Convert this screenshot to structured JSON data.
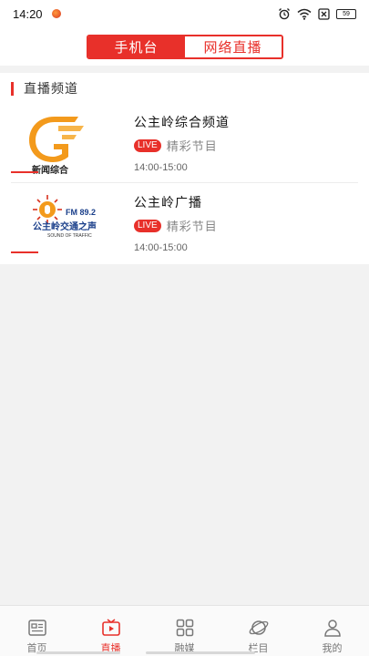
{
  "status_bar": {
    "time": "14:20",
    "battery": "59"
  },
  "header": {
    "tabs": [
      {
        "label": "手机台",
        "active": true
      },
      {
        "label": "网络直播",
        "active": false
      }
    ]
  },
  "section": {
    "title": "直播频道"
  },
  "channels": [
    {
      "name": "公主岭综合频道",
      "live": "LIVE",
      "program": "精彩节目",
      "time": "14:00-15:00",
      "logo_text": "新闻综合"
    },
    {
      "name": "公主岭广播",
      "live": "LIVE",
      "program": "精彩节目",
      "time": "14:00-15:00",
      "logo_freq": "FM 89.2",
      "logo_text": "公主岭交通之声",
      "logo_sub": "SOUND OF TRAFFIC"
    }
  ],
  "nav": {
    "items": [
      {
        "label": "首页",
        "icon": "news-icon"
      },
      {
        "label": "直播",
        "icon": "live-tv-icon",
        "active": true
      },
      {
        "label": "融媒",
        "icon": "grid-icon"
      },
      {
        "label": "栏目",
        "icon": "planet-icon"
      },
      {
        "label": "我的",
        "icon": "user-icon"
      }
    ]
  },
  "colors": {
    "accent": "#e8302a",
    "logo_orange": "#f39a1c"
  }
}
